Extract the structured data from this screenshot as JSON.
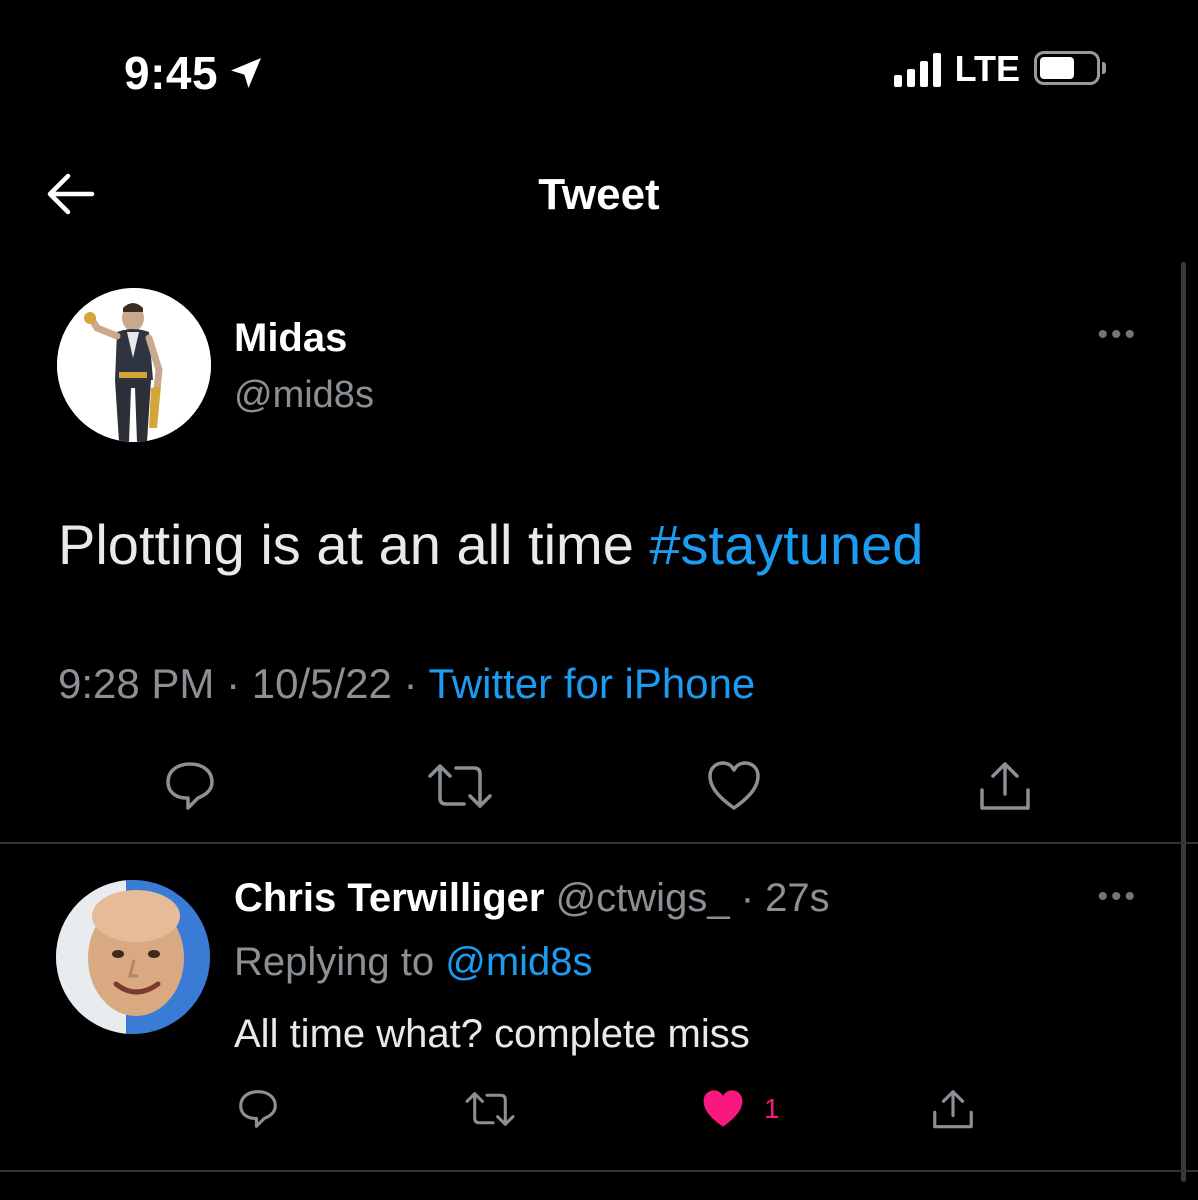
{
  "status_bar": {
    "time": "9:45",
    "network": "LTE",
    "icons": [
      "location-arrow-icon",
      "signal-icon",
      "battery-icon"
    ]
  },
  "nav": {
    "title": "Tweet",
    "back_icon": "back-arrow-icon"
  },
  "tweet": {
    "author_name": "Midas",
    "author_handle": "@mid8s",
    "text_plain": "Plotting is at an all time ",
    "hashtag": "#staytuned",
    "time": "9:28 PM",
    "separator": " · ",
    "date": "10/5/22",
    "source": "Twitter for iPhone",
    "more_icon": "more-dots-icon",
    "more_label": "•••",
    "actions": [
      "reply-icon",
      "retweet-icon",
      "like-icon",
      "share-icon"
    ]
  },
  "reply": {
    "author_name": "Chris Terwilliger",
    "author_handle": "@ctwigs_",
    "age": "· 27s",
    "replying_label": "Replying to ",
    "replying_to": "@mid8s",
    "text": "All time what? complete miss",
    "more_label": "•••",
    "like_count": "1",
    "liked": true,
    "actions": [
      "reply-icon",
      "retweet-icon",
      "like-filled-icon",
      "share-icon"
    ]
  },
  "colors": {
    "background": "#000000",
    "link": "#1d9bf0",
    "secondary_text": "#8b9095",
    "like": "#f91880",
    "divider": "#2f3336"
  }
}
